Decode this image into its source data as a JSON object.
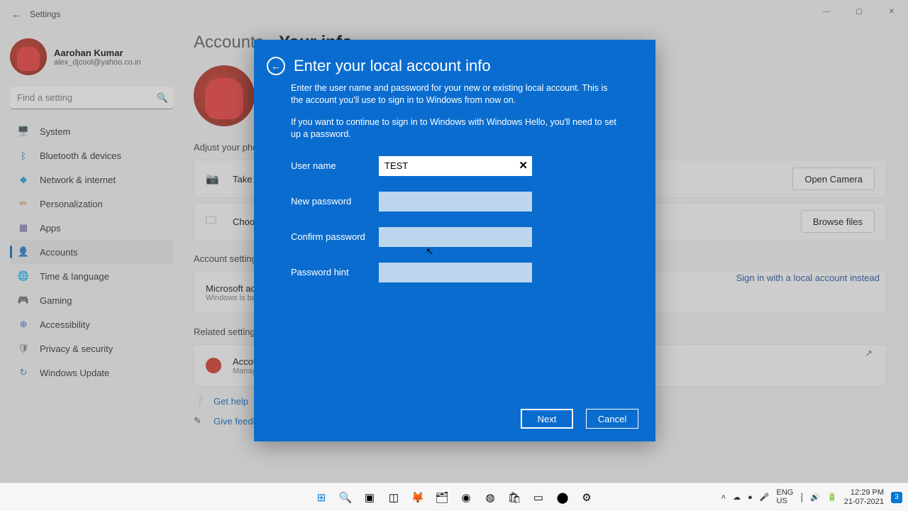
{
  "window": {
    "title": "Settings"
  },
  "user": {
    "name": "Aarohan Kumar",
    "email": "alex_djcool@yahoo.co.in"
  },
  "search": {
    "placeholder": "Find a setting"
  },
  "nav": [
    {
      "icon": "🖥️",
      "label": "System",
      "color": "#0067c0"
    },
    {
      "icon": "ᛒ",
      "label": "Bluetooth & devices",
      "color": "#0067c0"
    },
    {
      "icon": "◆",
      "label": "Network & internet",
      "color": "#1e9fd8"
    },
    {
      "icon": "✏",
      "label": "Personalization",
      "color": "#c98a3a"
    },
    {
      "icon": "▦",
      "label": "Apps",
      "color": "#5a4a9a"
    },
    {
      "icon": "👤",
      "label": "Accounts",
      "color": "#2a8a4a",
      "active": true
    },
    {
      "icon": "🌐",
      "label": "Time & language",
      "color": "#777"
    },
    {
      "icon": "🎮",
      "label": "Gaming",
      "color": "#777"
    },
    {
      "icon": "⊕",
      "label": "Accessibility",
      "color": "#2a6ad0"
    },
    {
      "icon": "🛡",
      "label": "Privacy & security",
      "color": "#777"
    },
    {
      "icon": "↻",
      "label": "Windows Update",
      "color": "#1a80d0"
    }
  ],
  "breadcrumb": {
    "parent": "Accounts",
    "sep": "›",
    "current": "Your info"
  },
  "sections": {
    "adjust": "Adjust your photo",
    "acct": "Account settings",
    "related": "Related settings"
  },
  "cards": {
    "take": {
      "label": "Take a photo",
      "button": "Open Camera"
    },
    "choose": {
      "label": "Choose a file",
      "button": "Browse files"
    },
    "ms": {
      "title": "Microsoft account",
      "sub": "Windows is better when settings sync",
      "link": "Sign in with a local account instead"
    },
    "accounts": {
      "title": "Accounts",
      "sub": "Manage"
    }
  },
  "help": {
    "gethelp": "Get help",
    "feedback": "Give feedback"
  },
  "modal": {
    "title": "Enter your local account info",
    "p1": "Enter the user name and password for your new or existing local account. This is the account you'll use to sign in to Windows from now on.",
    "p2": "If you want to continue to sign in to Windows with Windows Hello, you'll need to set up a password.",
    "labels": {
      "user": "User name",
      "newpw": "New password",
      "confirm": "Confirm password",
      "hint": "Password hint"
    },
    "username_value": "TEST",
    "next": "Next",
    "cancel": "Cancel"
  },
  "taskbar": {
    "lang1": "ENG",
    "lang2": "US",
    "time": "12:29 PM",
    "date": "21-07-2021",
    "notif": "3"
  }
}
